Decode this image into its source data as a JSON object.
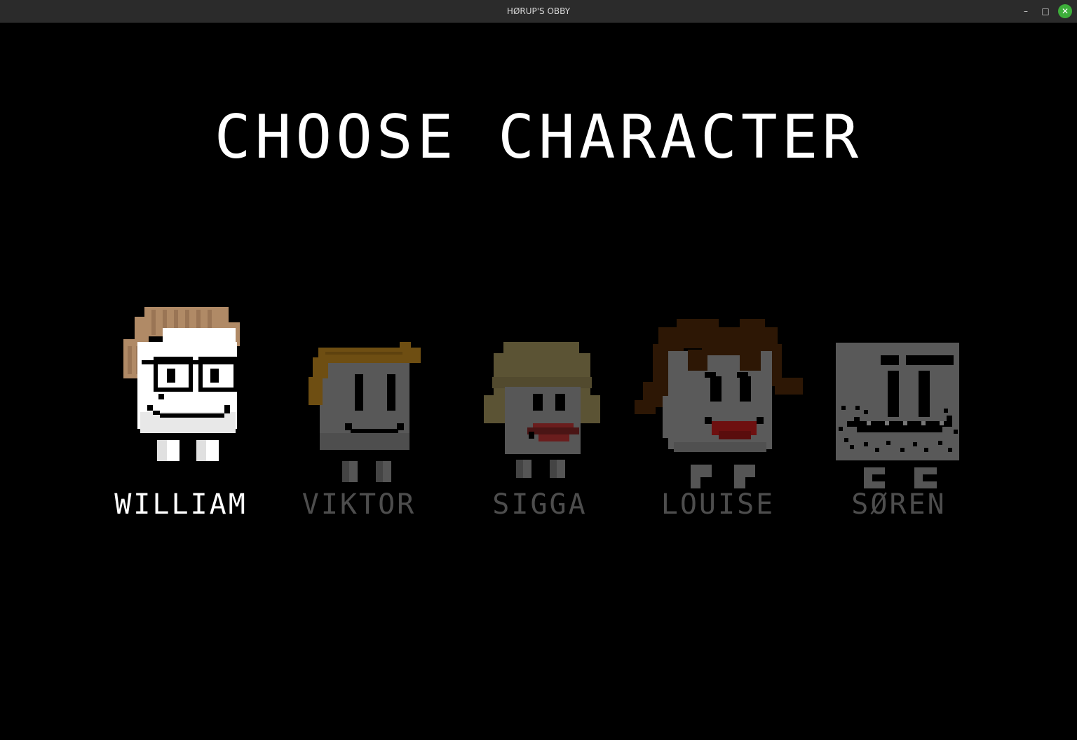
{
  "window": {
    "title": "HØRUP'S OBBY",
    "minimize": "–",
    "maximize": "□",
    "close": "✕"
  },
  "screen": {
    "heading": "CHOOSE CHARACTER"
  },
  "characters": [
    {
      "name": "WILLIAM",
      "selected": true,
      "icon": "william-sprite"
    },
    {
      "name": "VIKTOR",
      "selected": false,
      "icon": "viktor-sprite"
    },
    {
      "name": "SIGGA",
      "selected": false,
      "icon": "sigga-sprite"
    },
    {
      "name": "LOUISE",
      "selected": false,
      "icon": "louise-sprite"
    },
    {
      "name": "SØREN",
      "selected": false,
      "icon": "soren-sprite"
    }
  ],
  "colors": {
    "selected_text": "#ffffff",
    "dim_text": "#4d4d4d",
    "background": "#000000"
  }
}
